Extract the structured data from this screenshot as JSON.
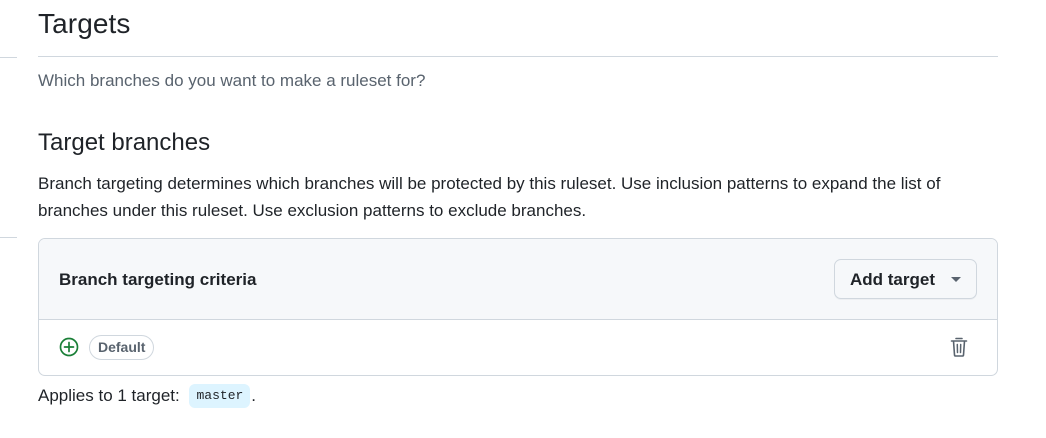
{
  "page": {
    "title": "Targets",
    "description": "Which branches do you want to make a ruleset for?"
  },
  "target_branches": {
    "title": "Target branches",
    "description": "Branch targeting determines which branches will be protected by this ruleset. Use inclusion patterns to expand the list of branches under this ruleset. Use exclusion patterns to exclude branches.",
    "criteria": {
      "title": "Branch targeting criteria",
      "add_button_label": "Add target",
      "items": [
        {
          "badge": "Default",
          "icon": "plus-circle-icon",
          "action_icon": "trash-icon"
        }
      ]
    },
    "applies": {
      "prefix": "Applies to 1 target: ",
      "target": "master",
      "suffix": "."
    }
  },
  "colors": {
    "plus_icon": "#1a7f37",
    "code_pill_bg": "#ddf4ff",
    "header_bg": "#f6f8fa",
    "border": "#d0d7de"
  }
}
